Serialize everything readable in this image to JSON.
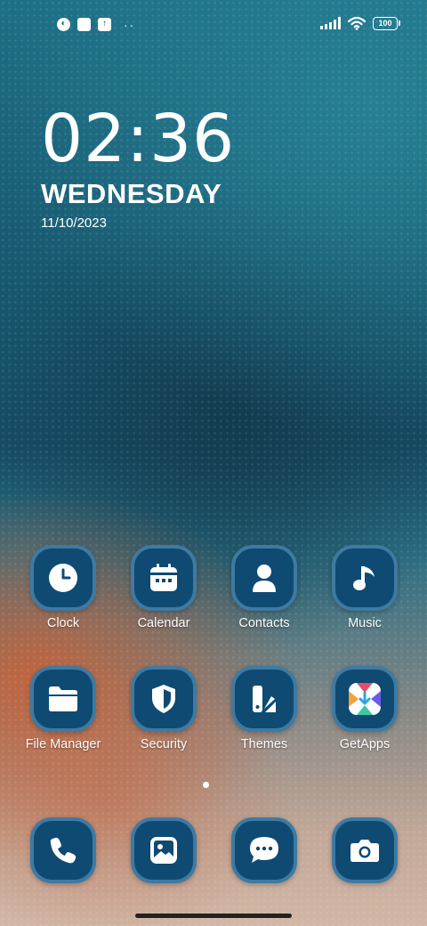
{
  "status_bar": {
    "left_icons": [
      "notification-app-icon",
      "square-notification-icon",
      "upload-icon",
      "more-dots-icon"
    ],
    "right_icons": [
      "signal-icon",
      "wifi-icon",
      "battery-icon"
    ],
    "battery_level": "100"
  },
  "clock_widget": {
    "time": "02:36",
    "day": "WEDNESDAY",
    "date": "11/10/2023"
  },
  "apps": [
    {
      "label": "Clock",
      "icon": "clock-icon"
    },
    {
      "label": "Calendar",
      "icon": "calendar-icon"
    },
    {
      "label": "Contacts",
      "icon": "contacts-icon"
    },
    {
      "label": "Music",
      "icon": "music-icon"
    },
    {
      "label": "File Manager",
      "icon": "folder-icon"
    },
    {
      "label": "Security",
      "icon": "shield-icon"
    },
    {
      "label": "Themes",
      "icon": "themes-icon"
    },
    {
      "label": "GetApps",
      "icon": "getapps-icon"
    }
  ],
  "dock": [
    {
      "icon": "phone-icon"
    },
    {
      "icon": "gallery-icon"
    },
    {
      "icon": "messages-icon"
    },
    {
      "icon": "camera-icon"
    }
  ],
  "page_indicator": {
    "pages": 1,
    "current": 1
  },
  "colors": {
    "icon_background": "#0f4a73",
    "icon_border": "#3e7aa2",
    "text": "#ffffff"
  }
}
